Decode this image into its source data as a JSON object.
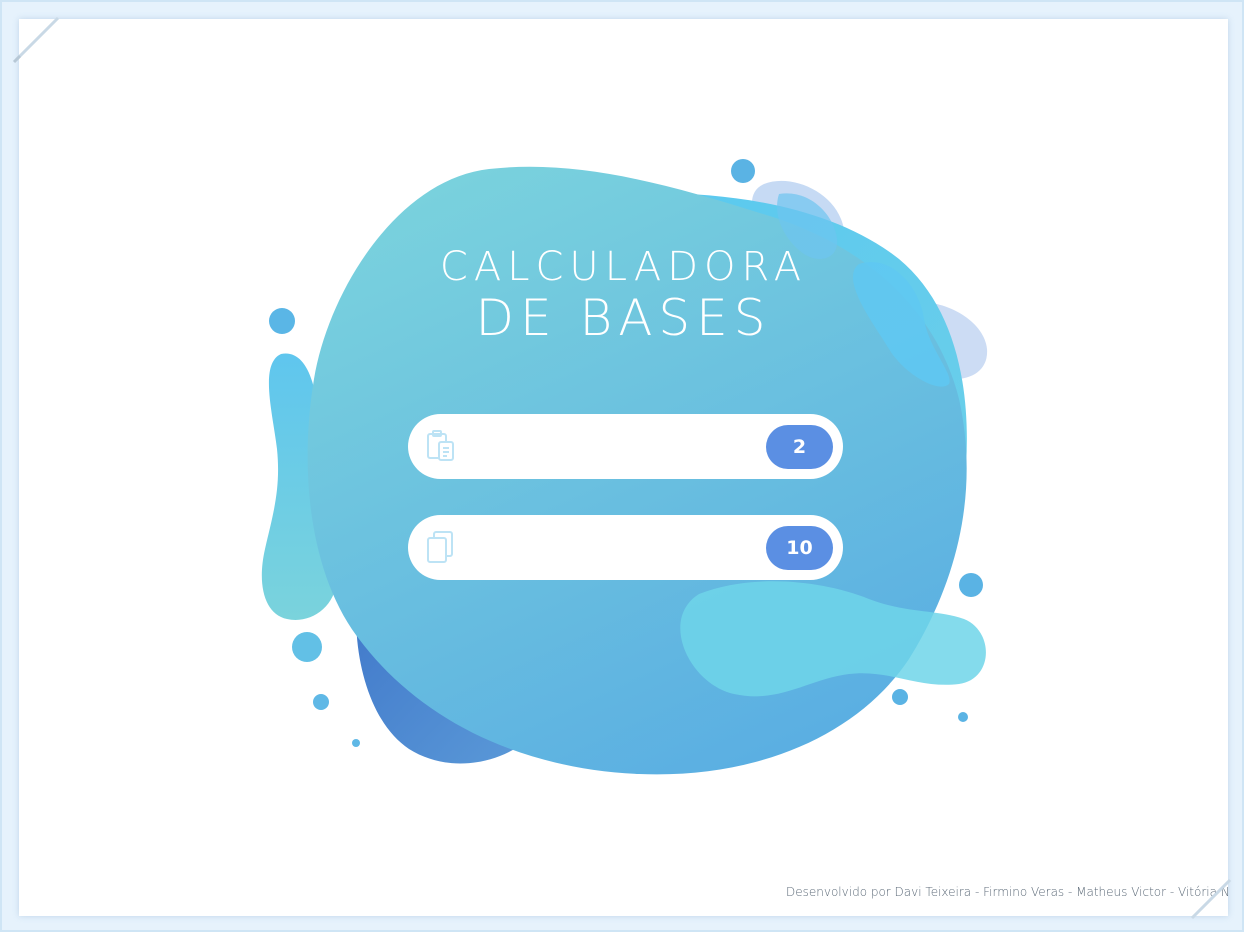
{
  "app": {
    "title_line1": "CALCULADORA",
    "title_line2": "DE BASES"
  },
  "fields": [
    {
      "icon": "clipboard-paste-icon",
      "value": "",
      "base_label": "2"
    },
    {
      "icon": "copy-icon",
      "value": "",
      "base_label": "10"
    }
  ],
  "footer": {
    "credits": "Desenvolvido por Davi Teixeira - Firmino Veras - Matheus Victor - Vitória N"
  },
  "colors": {
    "background": "#ffffff",
    "frame": "#e6f2fc",
    "blob_light": "#7ad1dd",
    "blob_main": "#5ab0e2",
    "blob_dark": "#4a7fd0",
    "pill": "#5b8fe3"
  }
}
